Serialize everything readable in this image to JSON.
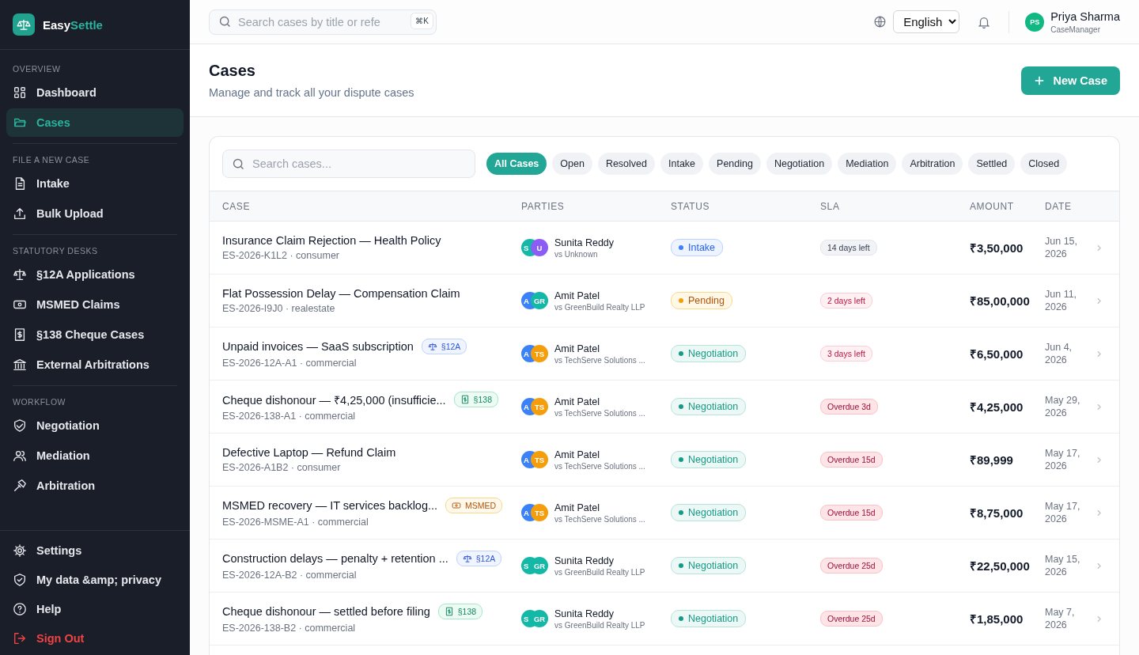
{
  "brand": {
    "first": "Easy",
    "second": "Settle"
  },
  "sidebar": {
    "sections": [
      {
        "title": "OVERVIEW",
        "items": [
          {
            "label": "Dashboard",
            "selected": false
          },
          {
            "label": "Cases",
            "selected": true
          }
        ]
      },
      {
        "title": "FILE A NEW CASE",
        "items": [
          {
            "label": "Intake",
            "selected": false
          },
          {
            "label": "Bulk Upload",
            "selected": false
          }
        ]
      },
      {
        "title": "STATUTORY DESKS",
        "items": [
          {
            "label": "§12A Applications",
            "selected": false
          },
          {
            "label": "MSMED Claims",
            "selected": false
          },
          {
            "label": "§138 Cheque Cases",
            "selected": false
          },
          {
            "label": "External Arbitrations",
            "selected": false
          }
        ]
      },
      {
        "title": "WORKFLOW",
        "items": [
          {
            "label": "Negotiation",
            "selected": false
          },
          {
            "label": "Mediation",
            "selected": false
          },
          {
            "label": "Arbitration",
            "selected": false
          }
        ]
      }
    ],
    "footer": [
      {
        "label": "Settings",
        "kind": "normal"
      },
      {
        "label": "My data &amp; privacy",
        "kind": "normal"
      },
      {
        "label": "Help",
        "kind": "normal"
      },
      {
        "label": "Sign Out",
        "kind": "danger"
      }
    ]
  },
  "topbar": {
    "search_placeholder": "Search cases by title or refe",
    "shortcut": "⌘K",
    "language": "English",
    "user": {
      "initials": "PS",
      "name": "Priya Sharma",
      "role": "CaseManager"
    }
  },
  "header": {
    "title": "Cases",
    "subtitle": "Manage and track all your dispute cases",
    "button": "New Case"
  },
  "filters": {
    "search_placeholder": "Search cases...",
    "chips": [
      {
        "label": "All Cases",
        "selected": true
      },
      {
        "label": "Open",
        "selected": false
      },
      {
        "label": "Resolved",
        "selected": false
      },
      {
        "label": "Intake",
        "selected": false
      },
      {
        "label": "Pending",
        "selected": false
      },
      {
        "label": "Negotiation",
        "selected": false
      },
      {
        "label": "Mediation",
        "selected": false
      },
      {
        "label": "Arbitration",
        "selected": false
      },
      {
        "label": "Settled",
        "selected": false
      },
      {
        "label": "Closed",
        "selected": false
      }
    ]
  },
  "table": {
    "columns": [
      "CASE",
      "PARTIES",
      "STATUS",
      "SLA",
      "AMOUNT",
      "DATE"
    ],
    "rows": [
      {
        "title": "Insurance Claim Rejection — Health Policy",
        "ref": "ES-2026-K1L2 · consumer",
        "avatars": [
          {
            "initials": "S",
            "color": "#14b8a6"
          },
          {
            "initials": "U",
            "color": "#8b5cf6"
          }
        ],
        "party": "Sunita Reddy",
        "opponent": "vs Unknown",
        "status": {
          "label": "Intake",
          "kind": "intake"
        },
        "sla": {
          "label": "14 days left",
          "kind": "normal"
        },
        "amount": "₹3,50,000",
        "date": "Jun 15, 2026"
      },
      {
        "title": "Flat Possession Delay — Compensation Claim",
        "ref": "ES-2026-I9J0 · realestate",
        "avatars": [
          {
            "initials": "A",
            "color": "#3b82f6"
          },
          {
            "initials": "GR",
            "color": "#14b8a6"
          }
        ],
        "party": "Amit Patel",
        "opponent": "vs GreenBuild Realty LLP",
        "status": {
          "label": "Pending",
          "kind": "pending"
        },
        "sla": {
          "label": "2 days left",
          "kind": "warning"
        },
        "amount": "₹85,00,000",
        "date": "Jun 11, 2026"
      },
      {
        "title": "Unpaid invoices — SaaS subscription",
        "ref": "ES-2026-12A-A1 · commercial",
        "tag": {
          "label": "§12A",
          "kind": "statute"
        },
        "avatars": [
          {
            "initials": "A",
            "color": "#3b82f6"
          },
          {
            "initials": "TS",
            "color": "#f59e0b"
          }
        ],
        "party": "Amit Patel",
        "opponent": "vs TechServe Solutions ...",
        "status": {
          "label": "Negotiation",
          "kind": "negotiation"
        },
        "sla": {
          "label": "3 days left",
          "kind": "warning"
        },
        "amount": "₹6,50,000",
        "date": "Jun 4, 2026"
      },
      {
        "title": "Cheque dishonour — ₹4,25,000 (insufficie...",
        "ref": "ES-2026-138-A1 · commercial",
        "tag": {
          "label": "§138",
          "kind": "cheque"
        },
        "avatars": [
          {
            "initials": "A",
            "color": "#3b82f6"
          },
          {
            "initials": "TS",
            "color": "#f59e0b"
          }
        ],
        "party": "Amit Patel",
        "opponent": "vs TechServe Solutions ...",
        "status": {
          "label": "Negotiation",
          "kind": "negotiation"
        },
        "sla": {
          "label": "Overdue 3d",
          "kind": "overdue"
        },
        "amount": "₹4,25,000",
        "date": "May 29, 2026"
      },
      {
        "title": "Defective Laptop — Refund Claim",
        "ref": "ES-2026-A1B2 · consumer",
        "avatars": [
          {
            "initials": "A",
            "color": "#3b82f6"
          },
          {
            "initials": "TS",
            "color": "#f59e0b"
          }
        ],
        "party": "Amit Patel",
        "opponent": "vs TechServe Solutions ...",
        "status": {
          "label": "Negotiation",
          "kind": "negotiation"
        },
        "sla": {
          "label": "Overdue 15d",
          "kind": "overdue"
        },
        "amount": "₹89,999",
        "date": "May 17, 2026"
      },
      {
        "title": "MSMED recovery — IT services backlog...",
        "ref": "ES-2026-MSME-A1 · commercial",
        "tag": {
          "label": "MSMED",
          "kind": "msmed"
        },
        "avatars": [
          {
            "initials": "A",
            "color": "#3b82f6"
          },
          {
            "initials": "TS",
            "color": "#f59e0b"
          }
        ],
        "party": "Amit Patel",
        "opponent": "vs TechServe Solutions ...",
        "status": {
          "label": "Negotiation",
          "kind": "negotiation"
        },
        "sla": {
          "label": "Overdue 15d",
          "kind": "overdue"
        },
        "amount": "₹8,75,000",
        "date": "May 17, 2026"
      },
      {
        "title": "Construction delays — penalty + retention ...",
        "ref": "ES-2026-12A-B2 · commercial",
        "tag": {
          "label": "§12A",
          "kind": "statute"
        },
        "avatars": [
          {
            "initials": "S",
            "color": "#14b8a6"
          },
          {
            "initials": "GR",
            "color": "#14b8a6"
          }
        ],
        "party": "Sunita Reddy",
        "opponent": "vs GreenBuild Realty LLP",
        "status": {
          "label": "Negotiation",
          "kind": "negotiation"
        },
        "sla": {
          "label": "Overdue 25d",
          "kind": "overdue"
        },
        "amount": "₹22,50,000",
        "date": "May 15, 2026"
      },
      {
        "title": "Cheque dishonour — settled before filing",
        "ref": "ES-2026-138-B2 · commercial",
        "tag": {
          "label": "§138",
          "kind": "cheque"
        },
        "avatars": [
          {
            "initials": "S",
            "color": "#14b8a6"
          },
          {
            "initials": "GR",
            "color": "#14b8a6"
          }
        ],
        "party": "Sunita Reddy",
        "opponent": "vs GreenBuild Realty LLP",
        "status": {
          "label": "Negotiation",
          "kind": "negotiation"
        },
        "sla": {
          "label": "Overdue 25d",
          "kind": "overdue"
        },
        "amount": "₹1,85,000",
        "date": "May 7, 2026"
      }
    ]
  }
}
